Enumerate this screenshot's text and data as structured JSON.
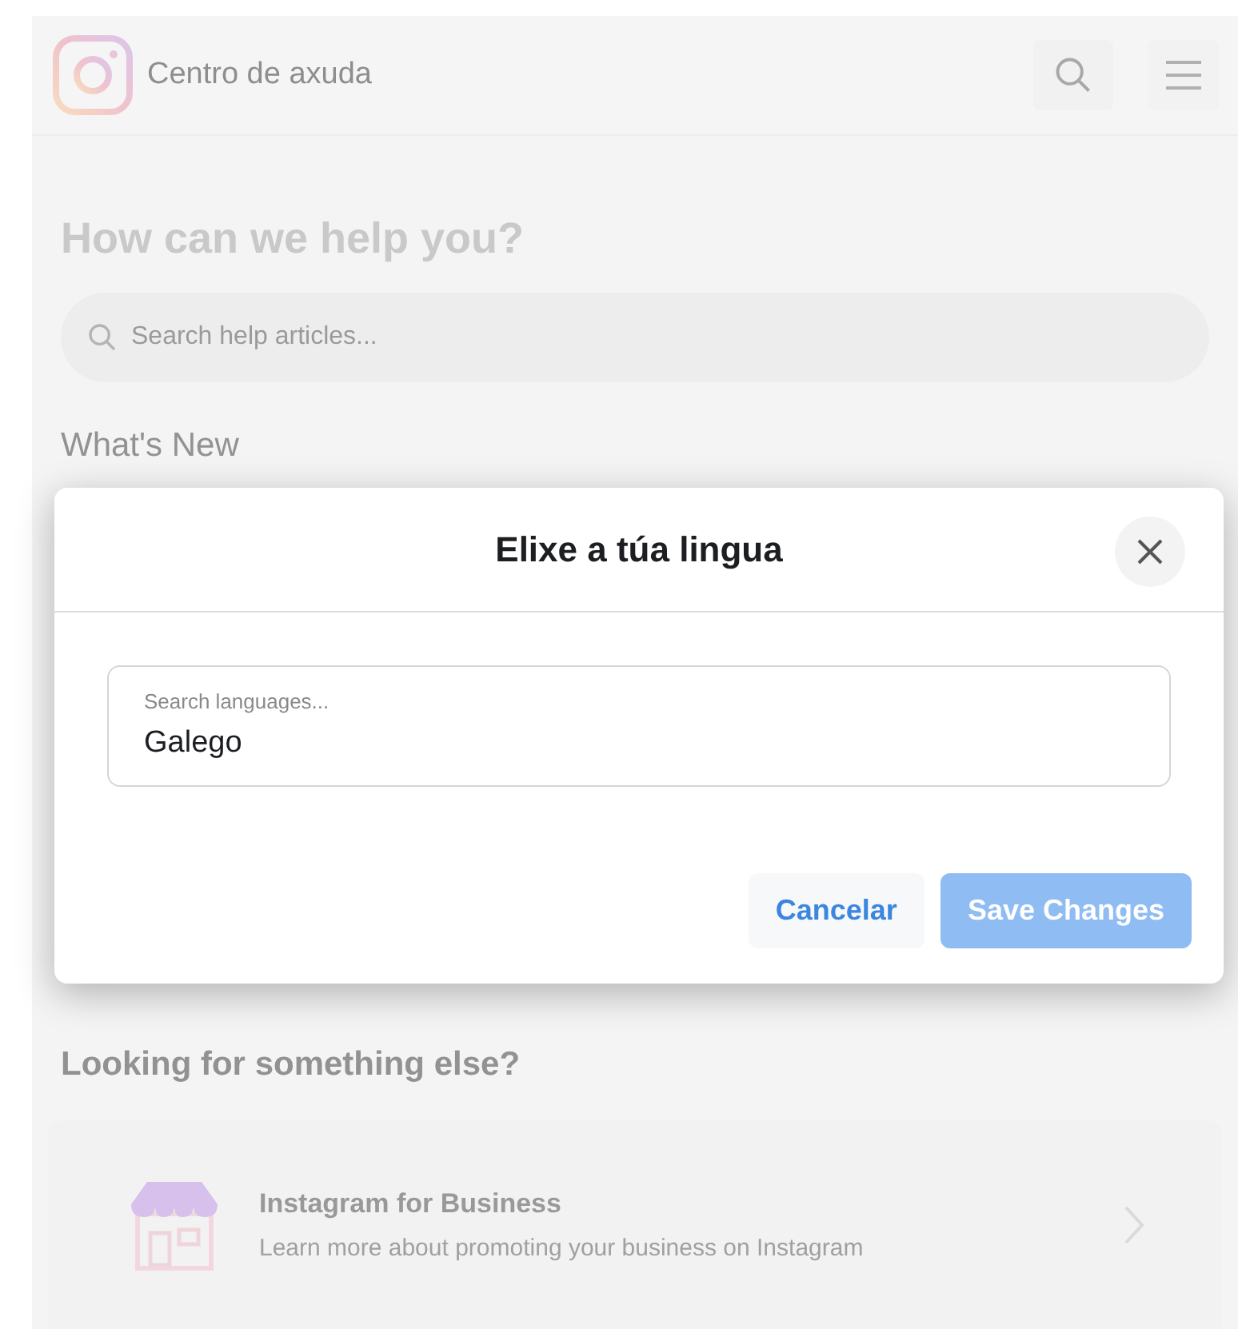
{
  "header": {
    "title": "Centro de axuda"
  },
  "hero": {
    "heading": "How can we help you?",
    "search": {
      "placeholder": "Search help articles..."
    }
  },
  "whats_new": {
    "heading": "What's New"
  },
  "modal": {
    "title": "Elixe a túa lingua",
    "field": {
      "label": "Search languages...",
      "value": "Galego"
    },
    "buttons": [
      {
        "label": "Cancelar",
        "kind": "secondary",
        "disabled": false
      },
      {
        "label": "Save Changes",
        "kind": "primary",
        "disabled": true
      }
    ]
  },
  "more": {
    "heading": "Looking for something else?",
    "cards": [
      {
        "title": "Instagram for Business",
        "description": "Learn more about promoting your business on Instagram"
      }
    ]
  }
}
